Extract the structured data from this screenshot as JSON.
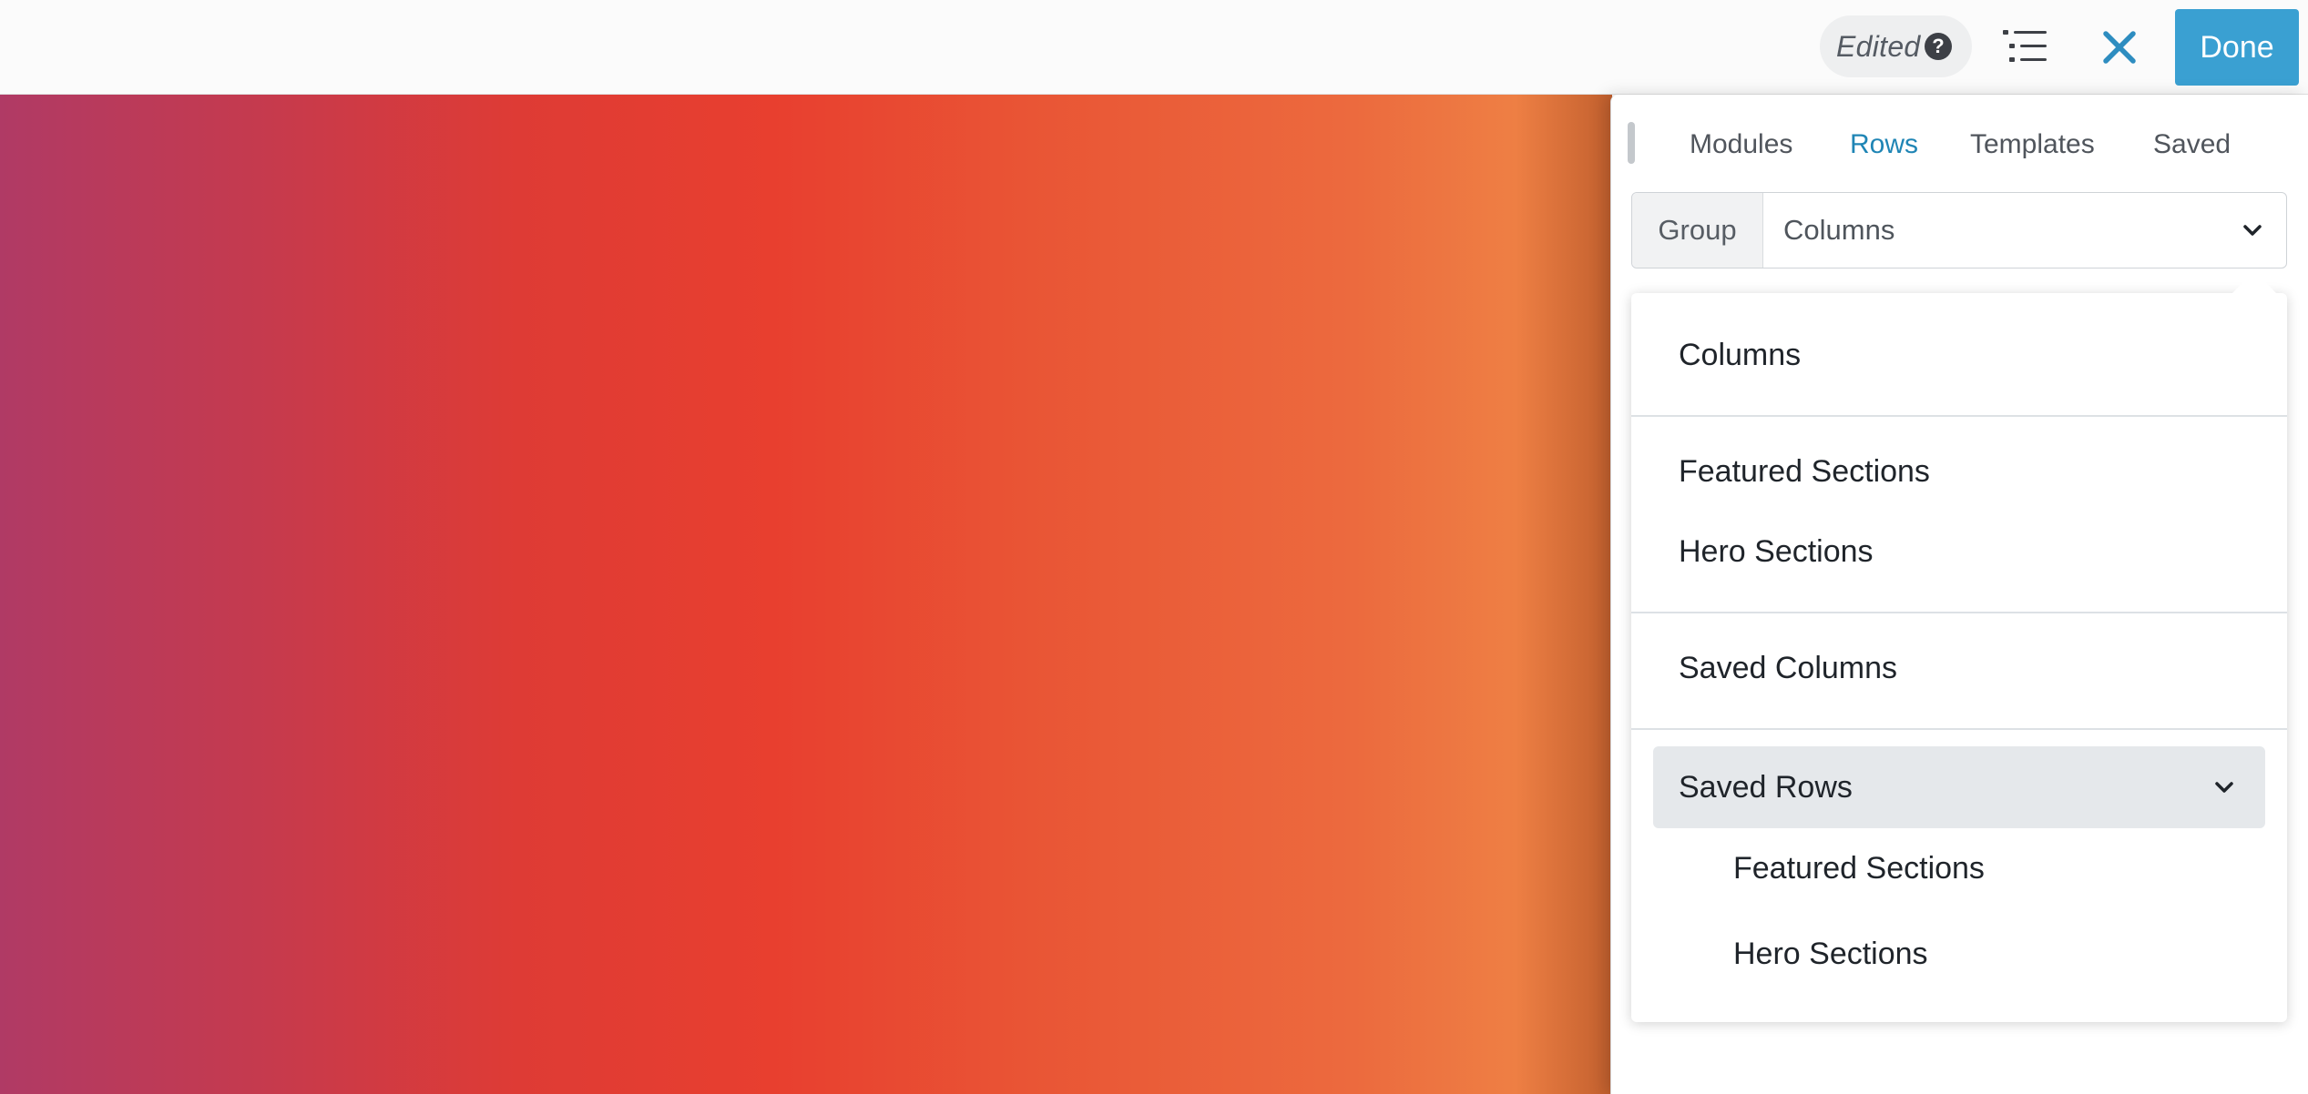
{
  "toolbar": {
    "status": "Edited",
    "help_icon": "question-circle-icon",
    "outline_icon": "outline-list-icon",
    "close_icon": "close-icon",
    "done_label": "Done",
    "accent_color": "#3aa0d2"
  },
  "panel": {
    "tabs": [
      {
        "label": "Modules",
        "active": false
      },
      {
        "label": "Rows",
        "active": true
      },
      {
        "label": "Templates",
        "active": false
      },
      {
        "label": "Saved",
        "active": false
      }
    ],
    "group_select": {
      "label": "Group",
      "value": "Columns"
    },
    "dropdown": {
      "items": [
        {
          "label": "Columns"
        },
        {
          "label": "Featured Sections"
        },
        {
          "label": "Hero Sections"
        },
        {
          "label": "Saved Columns"
        }
      ],
      "saved_rows": {
        "label": "Saved Rows",
        "expanded": true,
        "children": [
          {
            "label": "Featured Sections"
          },
          {
            "label": "Hero Sections"
          }
        ]
      }
    }
  }
}
